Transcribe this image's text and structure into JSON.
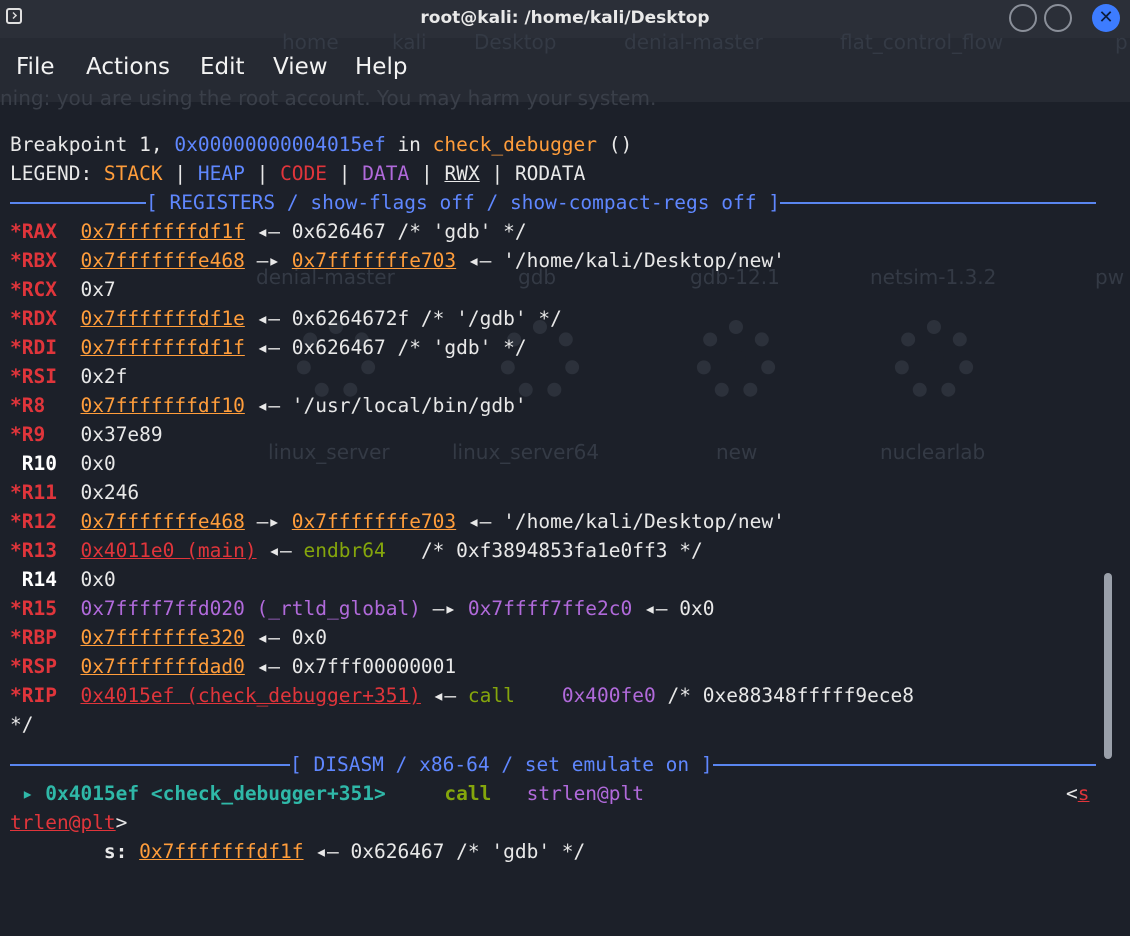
{
  "window": {
    "title": "root@kali: /home/kali/Desktop",
    "close_glyph": "✕"
  },
  "menu": [
    "File",
    "Actions",
    "Edit",
    "View",
    "Help"
  ],
  "background_ghost": {
    "warning": "ning: you are using the root account. You may harm your system.",
    "tabs": [
      "home",
      "kali",
      "Desktop",
      "denial-master",
      "flat_control_flow",
      "p"
    ],
    "icons": [
      "denial-master",
      "gdb",
      "gdb-12.1",
      "netsim-1.3.2",
      "pw",
      "linux_server",
      "linux_server64",
      "new",
      "nuclearlab"
    ]
  },
  "terminal": {
    "breakpoint": {
      "prefix": "Breakpoint 1, ",
      "address": "0x00000000004015ef",
      "in": " in ",
      "function": "check_debugger",
      "suffix": " ()"
    },
    "legend": {
      "label": "LEGEND: ",
      "stack": "STACK",
      "heap": "HEAP",
      "code": "CODE",
      "data": "DATA",
      "rwx": "RWX",
      "rodata": "RODATA",
      "sep": " | "
    },
    "registers_header": "[ REGISTERS / show-flags off / show-compact-regs off ]",
    "registers": [
      {
        "name": "*RAX",
        "value": "0x7fffffffdf1f",
        "rest": " ◂— 0x626467 /* 'gdb' */"
      },
      {
        "name": "*RBX",
        "value": "0x7fffffffe468",
        "arrow": " —▸ ",
        "target": "0x7fffffffe703",
        "rest": " ◂— '/home/kali/Desktop/new'"
      },
      {
        "name": "*RCX",
        "value": "0x7"
      },
      {
        "name": "*RDX",
        "value": "0x7fffffffdf1e",
        "rest": " ◂— 0x6264672f /* '/gdb' */"
      },
      {
        "name": "*RDI",
        "value": "0x7fffffffdf1f",
        "rest": " ◂— 0x626467 /* 'gdb' */"
      },
      {
        "name": "*RSI",
        "value": "0x2f"
      },
      {
        "name": "*R8",
        "value": "0x7fffffffdf10",
        "rest": " ◂— '/usr/local/bin/gdb'"
      },
      {
        "name": "*R9",
        "value": "0x37e89"
      },
      {
        "name": "R10",
        "value": "0x0"
      },
      {
        "name": "*R11",
        "value": "0x246"
      },
      {
        "name": "*R12",
        "value": "0x7fffffffe468",
        "arrow": " —▸ ",
        "target": "0x7fffffffe703",
        "rest": " ◂— '/home/kali/Desktop/new'"
      },
      {
        "name": "*R13",
        "value": "0x4011e0 (main)",
        "arrow": " ◂— ",
        "instr": "endbr64",
        "rest": "   /* 0xf3894853fa1e0ff3 */"
      },
      {
        "name": "R14",
        "value": "0x0"
      },
      {
        "name": "*R15",
        "value": "0x7ffff7ffd020 (_rtld_global)",
        "arrow": " —▸ ",
        "target": "0x7ffff7ffe2c0",
        "rest": " ◂— 0x0"
      },
      {
        "name": "*RBP",
        "value": "0x7fffffffe320",
        "rest": " ◂— 0x0"
      },
      {
        "name": "*RSP",
        "value": "0x7fffffffdad0",
        "rest": " ◂— 0x7fff00000001"
      },
      {
        "name": "*RIP",
        "value": "0x4015ef (check_debugger+351)",
        "arrow": " ◂— ",
        "instr": "call",
        "target": "0x400fe0",
        "rest": " /* 0xe88348fffff9ece8"
      }
    ],
    "rip_wrap": "*/",
    "disasm_header": "[ DISASM / x86-64 / set emulate on ]",
    "disasm": {
      "marker": "▸ ",
      "address": "0x4015ef <check_debugger+351>",
      "mnemonic": "call",
      "operand": "strlen@plt",
      "sym_open": "<",
      "sym_s": "s",
      "sym_rest": "trlen@plt",
      "sym_close": ">"
    },
    "arg": {
      "label": "s: ",
      "value": "0x7fffffffdf1f",
      "rest": " ◂— 0x626467 /* 'gdb' */"
    }
  }
}
